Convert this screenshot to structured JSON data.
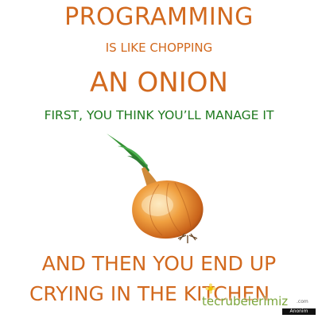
{
  "lines": {
    "l1": "PROGRAMMING",
    "l2": "IS LIKE CHOPPING",
    "l3": "AN ONION",
    "l4": "FIRST, YOU THINK YOU’LL MANAGE IT",
    "l5": "AND THEN YOU END UP",
    "l6": "CRYING IN THE KITCHEN"
  },
  "watermark": {
    "text": "tecrubelerimiz",
    "suffix": ".com",
    "badge": "Anonim"
  },
  "colors": {
    "orange_text": "#d2691e",
    "green_text": "#1f7a1f",
    "onion_body": "#e07a1f",
    "sprout": "#2e8b2e"
  },
  "icons": [
    "onion-illustration",
    "flower-logo-icon"
  ]
}
